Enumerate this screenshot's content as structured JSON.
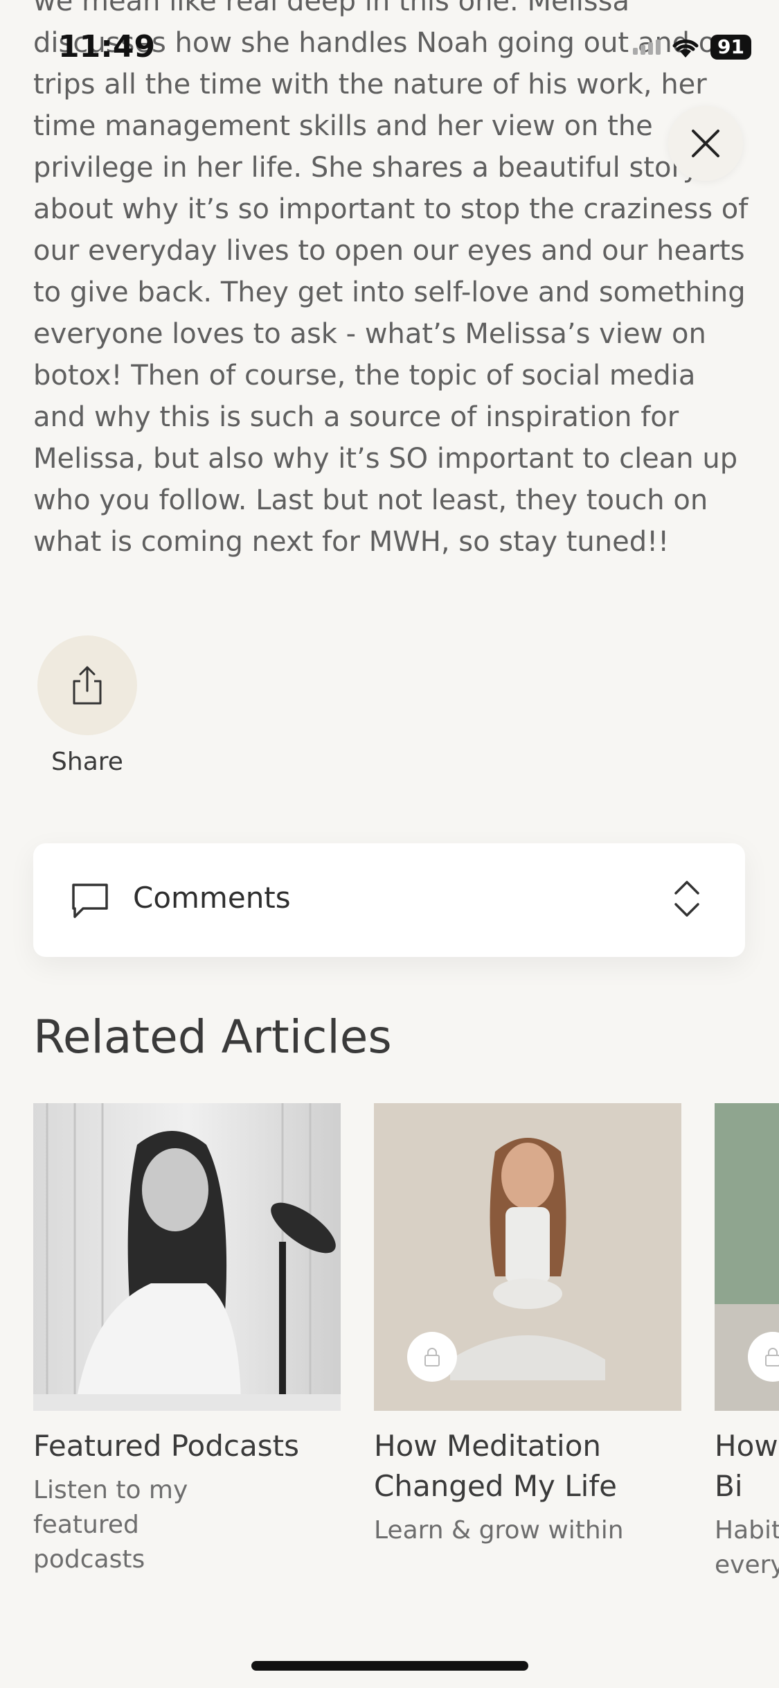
{
  "status_bar": {
    "time": "11:49",
    "battery": "91"
  },
  "description": "we mean like real deep in this one. Melissa discusses how she handles Noah going out and on trips all the time with the nature of his work, her time management skills and her view on the privilege in her life. She shares a beautiful story about why it’s so important to stop the craziness of our everyday lives to open our eyes and our hearts to give back. They get into self-love and something everyone loves to ask - what’s Melissa’s view on botox! Then of course, the topic of social media and why this is such a source of inspiration for Melissa, but also why it’s SO important to clean up who you follow. Last but not least, they touch on what is coming next for MWH, so stay tuned!!",
  "actions": {
    "share_label": "Share",
    "close_icon": "close-icon",
    "share_icon": "share-icon"
  },
  "comments": {
    "label": "Comments",
    "icon": "comment-icon",
    "toggle_icon": "chevron-updown-icon"
  },
  "related": {
    "heading": "Related Articles",
    "cards": [
      {
        "title": "Featured Podcasts",
        "subtitle": "Listen to my featured podcasts",
        "locked": false
      },
      {
        "title": "How Meditation Changed My Life",
        "subtitle": "Learn & grow within",
        "locked": true
      },
      {
        "title": "How To Bi",
        "subtitle": "Habit every",
        "locked": true
      }
    ]
  },
  "colors": {
    "background": "#f7f6f3",
    "share_button": "#efeadf",
    "text": "#5f5f5f"
  }
}
